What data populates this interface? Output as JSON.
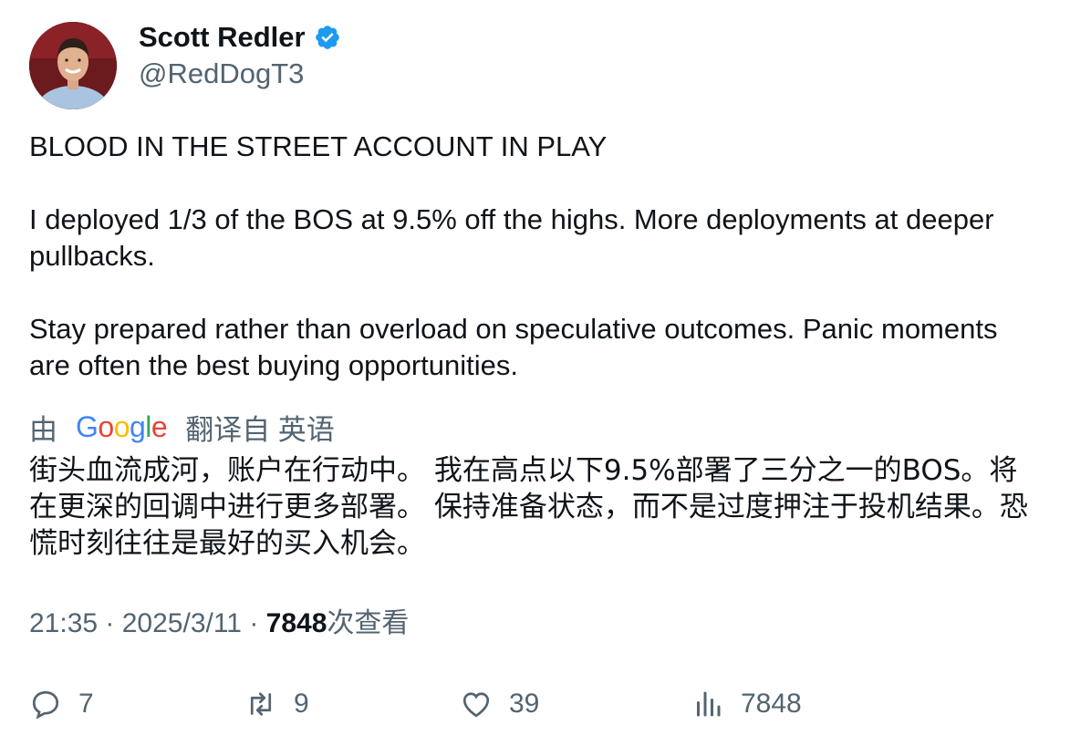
{
  "author": {
    "name": "Scott Redler",
    "handle": "@RedDogT3",
    "verified_color": "#1d9bf0"
  },
  "tweet": {
    "lines": [
      "BLOOD IN THE STREET ACCOUNT IN PLAY",
      "I deployed 1/3 of the BOS at 9.5% off the highs. More deployments at deeper",
      "pullbacks.",
      "Stay prepared rather than overload on speculative outcomes. Panic moments",
      "are often the best buying opportunities."
    ]
  },
  "translation": {
    "prefix": "由",
    "logo_letters": [
      "G",
      "o",
      "o",
      "g",
      "l",
      "e"
    ],
    "logo_colors": [
      "#4285f4",
      "#ea4335",
      "#fbbc05",
      "#4285f4",
      "#34a853",
      "#ea4335"
    ],
    "suffix": "翻译自 英语",
    "lines": [
      "街头血流成河，账户在行动中。 我在高点以下9.5%部署了三分之一的BOS。将",
      "在更深的回调中进行更多部署。 保持准备状态，而不是过度押注于投机结果。恐",
      "慌时刻往往是最好的买入机会。"
    ]
  },
  "meta": {
    "time": "21:35",
    "separator": " · ",
    "date": "2025/3/11",
    "views_count": "7848",
    "views_label": "次查看"
  },
  "actions": {
    "reply": {
      "icon": "reply-icon",
      "count": "7"
    },
    "retweet": {
      "icon": "retweet-icon",
      "count": "9"
    },
    "like": {
      "icon": "heart-icon",
      "count": "39"
    },
    "views": {
      "icon": "analytics-icon",
      "count": "7848"
    }
  }
}
